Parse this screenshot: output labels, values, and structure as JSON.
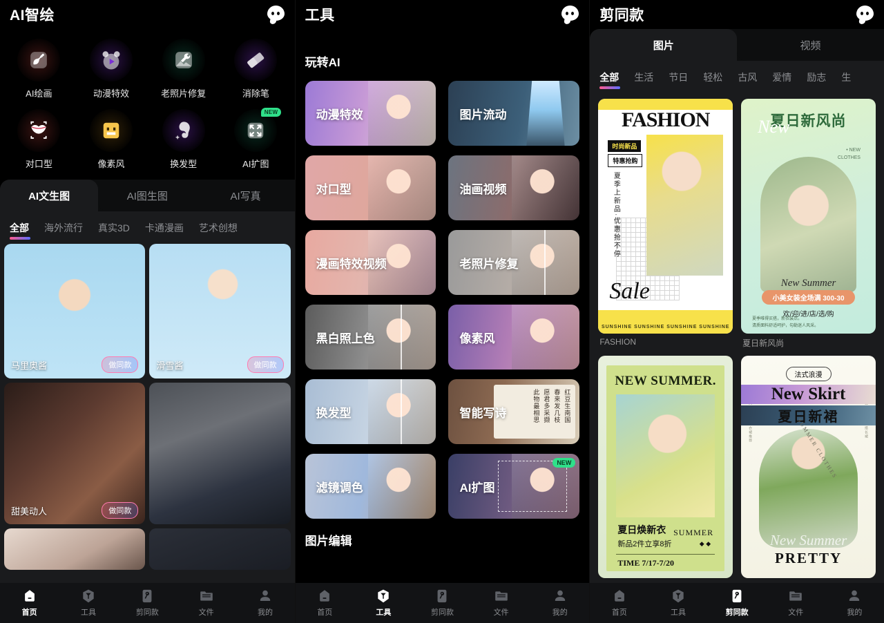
{
  "screens": [
    {
      "id": "ai-draw",
      "header": {
        "title": "AI智绘",
        "chat_icon": "chat-bubble-icon"
      },
      "icon_grid": [
        {
          "label": "AI绘画",
          "icon": "brush-icon",
          "circle": "#3a1412",
          "glyph": "#ef5656",
          "badge": ""
        },
        {
          "label": "动漫特效",
          "icon": "anime-bear-icon",
          "circle": "#2a1145",
          "glyph": "#a461f5",
          "badge": ""
        },
        {
          "label": "老照片修复",
          "icon": "wrench-photo-icon",
          "circle": "#08281e",
          "glyph": "#2fd98d",
          "badge": ""
        },
        {
          "label": "消除笔",
          "icon": "eraser-icon",
          "circle": "#2a1145",
          "glyph": "#b36cf7",
          "badge": ""
        },
        {
          "label": "对口型",
          "icon": "lips-icon",
          "circle": "#3a1412",
          "glyph": "#f0566e",
          "badge": ""
        },
        {
          "label": "像素风",
          "icon": "pixel-face-icon",
          "circle": "#2e2008",
          "glyph": "#f5b43c",
          "badge": ""
        },
        {
          "label": "换发型",
          "icon": "hairstyle-icon",
          "circle": "#2a1145",
          "glyph": "#a461f5",
          "badge": ""
        },
        {
          "label": "AI扩图",
          "icon": "expand-image-icon",
          "circle": "#08281e",
          "glyph": "#2fd98d",
          "badge": "NEW"
        }
      ],
      "tabs": [
        {
          "label": "AI文生图",
          "active": true
        },
        {
          "label": "AI图生图",
          "active": false
        },
        {
          "label": "AI写真",
          "active": false
        }
      ],
      "chips": [
        {
          "label": "全部",
          "active": true
        },
        {
          "label": "海外流行",
          "active": false
        },
        {
          "label": "真实3D",
          "active": false
        },
        {
          "label": "卡通漫画",
          "active": false
        },
        {
          "label": "艺术创想",
          "active": false
        }
      ],
      "gallery": [
        {
          "caption": "马里奥酱",
          "pill": "做同款",
          "art": "art-chibi1",
          "size": "h1"
        },
        {
          "caption": "滑雪酱",
          "pill": "做同款",
          "art": "art-chibi2",
          "size": "h1"
        },
        {
          "caption": "甜美动人",
          "pill": "做同款",
          "art": "art-lady",
          "size": "h2"
        },
        {
          "caption": "",
          "pill": "",
          "art": "art-police",
          "size": "h2"
        },
        {
          "caption": "",
          "pill": "",
          "art": "art-face",
          "size": "h3"
        },
        {
          "caption": "",
          "pill": "",
          "art": "art-dark",
          "size": "h3"
        }
      ],
      "nav_active": "首页"
    },
    {
      "id": "tools",
      "header": {
        "title": "工具",
        "chat_icon": "chat-bubble-icon"
      },
      "section_title": "玩转AI",
      "section_title_bottom": "图片编辑",
      "tools": [
        {
          "label": "动漫特效",
          "badge": "",
          "theme": "t1",
          "photo": "ph-girl",
          "split": false
        },
        {
          "label": "图片流动",
          "badge": "",
          "theme": "t2",
          "photo": "ph-water",
          "split": false
        },
        {
          "label": "对口型",
          "badge": "",
          "theme": "t3",
          "photo": "ph-girl",
          "split": false
        },
        {
          "label": "油画视频",
          "badge": "",
          "theme": "t4",
          "photo": "ph-girl",
          "split": false
        },
        {
          "label": "漫画特效视频",
          "badge": "",
          "theme": "t5",
          "photo": "ph-girl",
          "split": false
        },
        {
          "label": "老照片修复",
          "badge": "",
          "theme": "t6",
          "photo": "ph-girl",
          "split": true
        },
        {
          "label": "黑白照上色",
          "badge": "",
          "theme": "t7",
          "photo": "ph-girl",
          "split": true
        },
        {
          "label": "像素风",
          "badge": "",
          "theme": "t8",
          "photo": "ph-girl",
          "split": false
        },
        {
          "label": "换发型",
          "badge": "",
          "theme": "t9",
          "photo": "ph-girl",
          "split": true
        },
        {
          "label": "智能写诗",
          "badge": "",
          "theme": "t10",
          "photo": "",
          "split": false,
          "poem": [
            "红豆生南国",
            "春来发几枝",
            "愿君多采撷",
            "此物最相思"
          ]
        },
        {
          "label": "滤镜调色",
          "badge": "",
          "theme": "t11",
          "photo": "ph-girl",
          "split": false
        },
        {
          "label": "AI扩图",
          "badge": "NEW",
          "theme": "t12",
          "photo": "ph-girl",
          "split": false,
          "dash": true
        }
      ],
      "nav_active": "工具"
    },
    {
      "id": "templates",
      "header": {
        "title": "剪同款",
        "chat_icon": "chat-bubble-icon"
      },
      "tabs": [
        {
          "label": "图片",
          "active": true
        },
        {
          "label": "视频",
          "active": false
        }
      ],
      "chips": [
        {
          "label": "全部",
          "active": true
        },
        {
          "label": "生活",
          "active": false
        },
        {
          "label": "节日",
          "active": false
        },
        {
          "label": "轻松",
          "active": false
        },
        {
          "label": "古风",
          "active": false
        },
        {
          "label": "爱情",
          "active": false
        },
        {
          "label": "励志",
          "active": false
        },
        {
          "label": "生",
          "active": false
        }
      ],
      "templates": [
        {
          "name": "FASHION",
          "style": "p1",
          "texts": {
            "title": "FASHION",
            "tag1": "时尚新品",
            "tag2": "特惠抢购",
            "vertical": "夏季上新品·优惠抢不停",
            "script": "Sale",
            "footer": "SUNSHINE  SUNSHINE  SUNSHINE  SUNSHINE"
          }
        },
        {
          "name": "夏日新风尚",
          "style": "p2",
          "texts": {
            "title": "夏日新风尚",
            "script": "New",
            "corner": "• NEW\nCLOTHES",
            "sub": "New Summer",
            "band": "小美女装全场满 300-30",
            "band2": "欢/迎/进/店/选/购",
            "footer": "夏季唯得买搭，新衣装点。\n清质面料舒适呵护，勾勒迷人风采。"
          }
        },
        {
          "name": "",
          "style": "p3",
          "texts": {
            "title": "NEW SUMMER.",
            "c1": "夏日焕新衣",
            "c2": "新品2件立享8折",
            "c3": "SUMMER",
            "time": "TIME 7/17-7/20"
          }
        },
        {
          "name": "",
          "style": "p4",
          "texts": {
            "badge": "法式浪漫",
            "title_en": "New Skirt",
            "title_cn": "夏日新裙",
            "arc": "SUMMER CLOTHES",
            "script": "New Summer",
            "pretty": "PRETTY",
            "side_left": "时尚新款夏季连衣裙推荐",
            "side_right": "优雅气质显瘦百搭长裙"
          }
        }
      ],
      "nav_active": "剪同款"
    }
  ],
  "nav": [
    {
      "label": "首页",
      "icon": "home-icon"
    },
    {
      "label": "工具",
      "icon": "tools-icon"
    },
    {
      "label": "剪同款",
      "icon": "magic-wand-icon"
    },
    {
      "label": "文件",
      "icon": "folder-icon"
    },
    {
      "label": "我的",
      "icon": "person-icon"
    }
  ],
  "colors": {
    "accent_start": "#ff5b8d",
    "accent_end": "#5b6dff",
    "new_badge": "#2fe08a",
    "bg": "#000000",
    "sheet": "#1a1b1d"
  }
}
